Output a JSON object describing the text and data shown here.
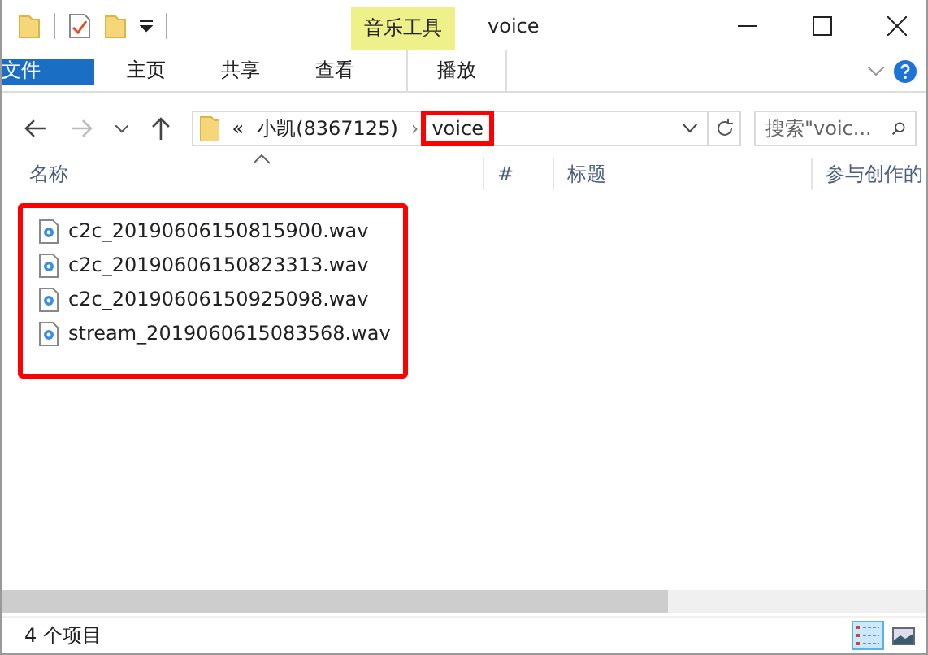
{
  "window": {
    "title": "voice"
  },
  "ribbon": {
    "context_group": "音乐工具",
    "tabs": [
      {
        "label": "文件",
        "kind": "file"
      },
      {
        "label": "主页",
        "kind": "normal"
      },
      {
        "label": "共享",
        "kind": "normal"
      },
      {
        "label": "查看",
        "kind": "normal"
      },
      {
        "label": "播放",
        "kind": "context"
      }
    ]
  },
  "address": {
    "overflow": "«",
    "segments": [
      {
        "label": "小凯(8367125)",
        "highlighted": false
      },
      {
        "label": "voice",
        "highlighted": true
      }
    ],
    "separator": "›"
  },
  "search": {
    "placeholder": "搜索\"voic..."
  },
  "columns": [
    "名称",
    "#",
    "标题",
    "参与创作的"
  ],
  "files": {
    "highlighted": true,
    "items": [
      {
        "name": "c2c_20190606150815900.wav"
      },
      {
        "name": "c2c_20190606150823313.wav"
      },
      {
        "name": "c2c_20190606150925098.wav"
      },
      {
        "name": "stream_2019060615083568.wav"
      }
    ]
  },
  "status_bar": {
    "count": "4 个项目",
    "views": [
      {
        "kind": "details",
        "selected": true
      },
      {
        "kind": "large",
        "selected": false
      }
    ]
  }
}
